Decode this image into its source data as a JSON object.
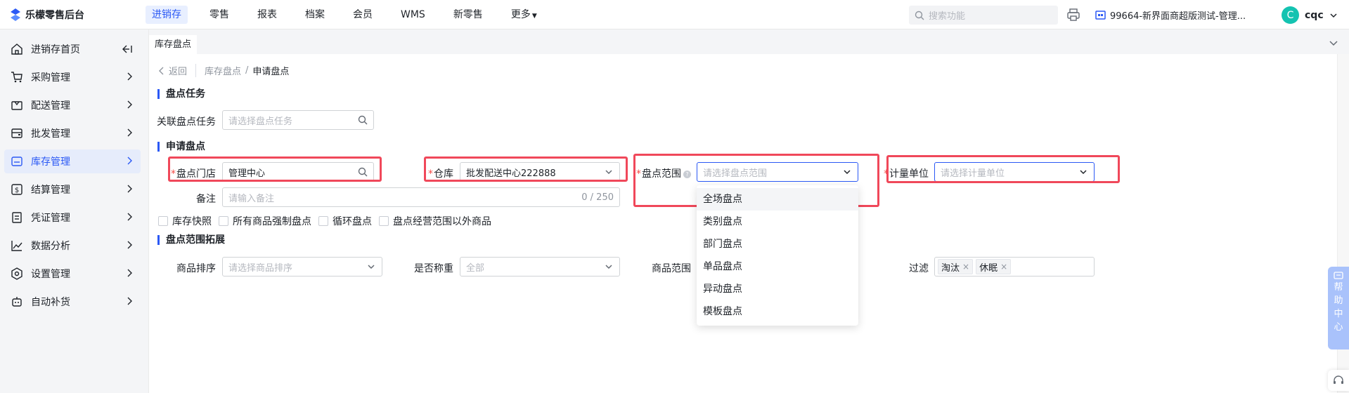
{
  "app": {
    "title": "乐檬零售后台"
  },
  "topnav": {
    "items": [
      "进销存",
      "零售",
      "报表",
      "档案",
      "会员",
      "WMS",
      "新零售"
    ],
    "more": "更多",
    "search_placeholder": "搜索功能",
    "store": "99664-新界面商超版测试-管理...",
    "user_initial": "C",
    "user_name": "cqc"
  },
  "sidebar": {
    "items": [
      {
        "label": "进销存首页",
        "icon": "home-icon"
      },
      {
        "label": "采购管理",
        "icon": "cart-icon"
      },
      {
        "label": "配送管理",
        "icon": "box-icon"
      },
      {
        "label": "批发管理",
        "icon": "wallet-icon"
      },
      {
        "label": "库存管理",
        "icon": "inventory-icon"
      },
      {
        "label": "结算管理",
        "icon": "dollar-icon"
      },
      {
        "label": "凭证管理",
        "icon": "voucher-icon"
      },
      {
        "label": "数据分析",
        "icon": "chart-icon"
      },
      {
        "label": "设置管理",
        "icon": "settings-icon"
      },
      {
        "label": "自动补货",
        "icon": "robot-icon"
      }
    ],
    "active_index": 4
  },
  "tabs": {
    "current": "库存盘点"
  },
  "breadcrumb": {
    "back": "返回",
    "parent": "库存盘点",
    "sep": "/",
    "current": "申请盘点"
  },
  "section_task": {
    "title": "盘点任务",
    "related_label": "关联盘点任务",
    "related_placeholder": "请选择盘点任务"
  },
  "section_apply": {
    "title": "申请盘点",
    "required_mark": "*",
    "store_label": "盘点门店",
    "store_value": "管理中心",
    "warehouse_label": "仓库",
    "warehouse_value": "批发配送中心222888",
    "scope_label": "盘点范围",
    "scope_placeholder": "请选择盘点范围",
    "unit_label": "计量单位",
    "unit_placeholder": "请选择计量单位",
    "remark_label": "备注",
    "remark_placeholder": "请输入备注",
    "remark_counter": "0 / 250",
    "checkboxes": [
      "库存快照",
      "所有商品强制盘点",
      "循环盘点",
      "盘点经营范围以外商品"
    ]
  },
  "section_extend": {
    "title": "盘点范围拓展",
    "sort_label": "商品排序",
    "sort_placeholder": "请选择商品排序",
    "weigh_label": "是否称重",
    "weigh_value": "全部",
    "range_label": "商品范围",
    "filter_label": "过滤",
    "filter_tags": [
      "淘汰",
      "休眠"
    ]
  },
  "scope_dropdown": {
    "options": [
      "全场盘点",
      "类别盘点",
      "部门盘点",
      "单品盘点",
      "异动盘点",
      "模板盘点"
    ],
    "highlighted_index": 0
  },
  "help": {
    "chars": [
      "帮",
      "助",
      "中",
      "心"
    ]
  },
  "colors": {
    "accent": "#2b59f5",
    "highlight_box": "#f0485a",
    "required": "#f54a45"
  }
}
